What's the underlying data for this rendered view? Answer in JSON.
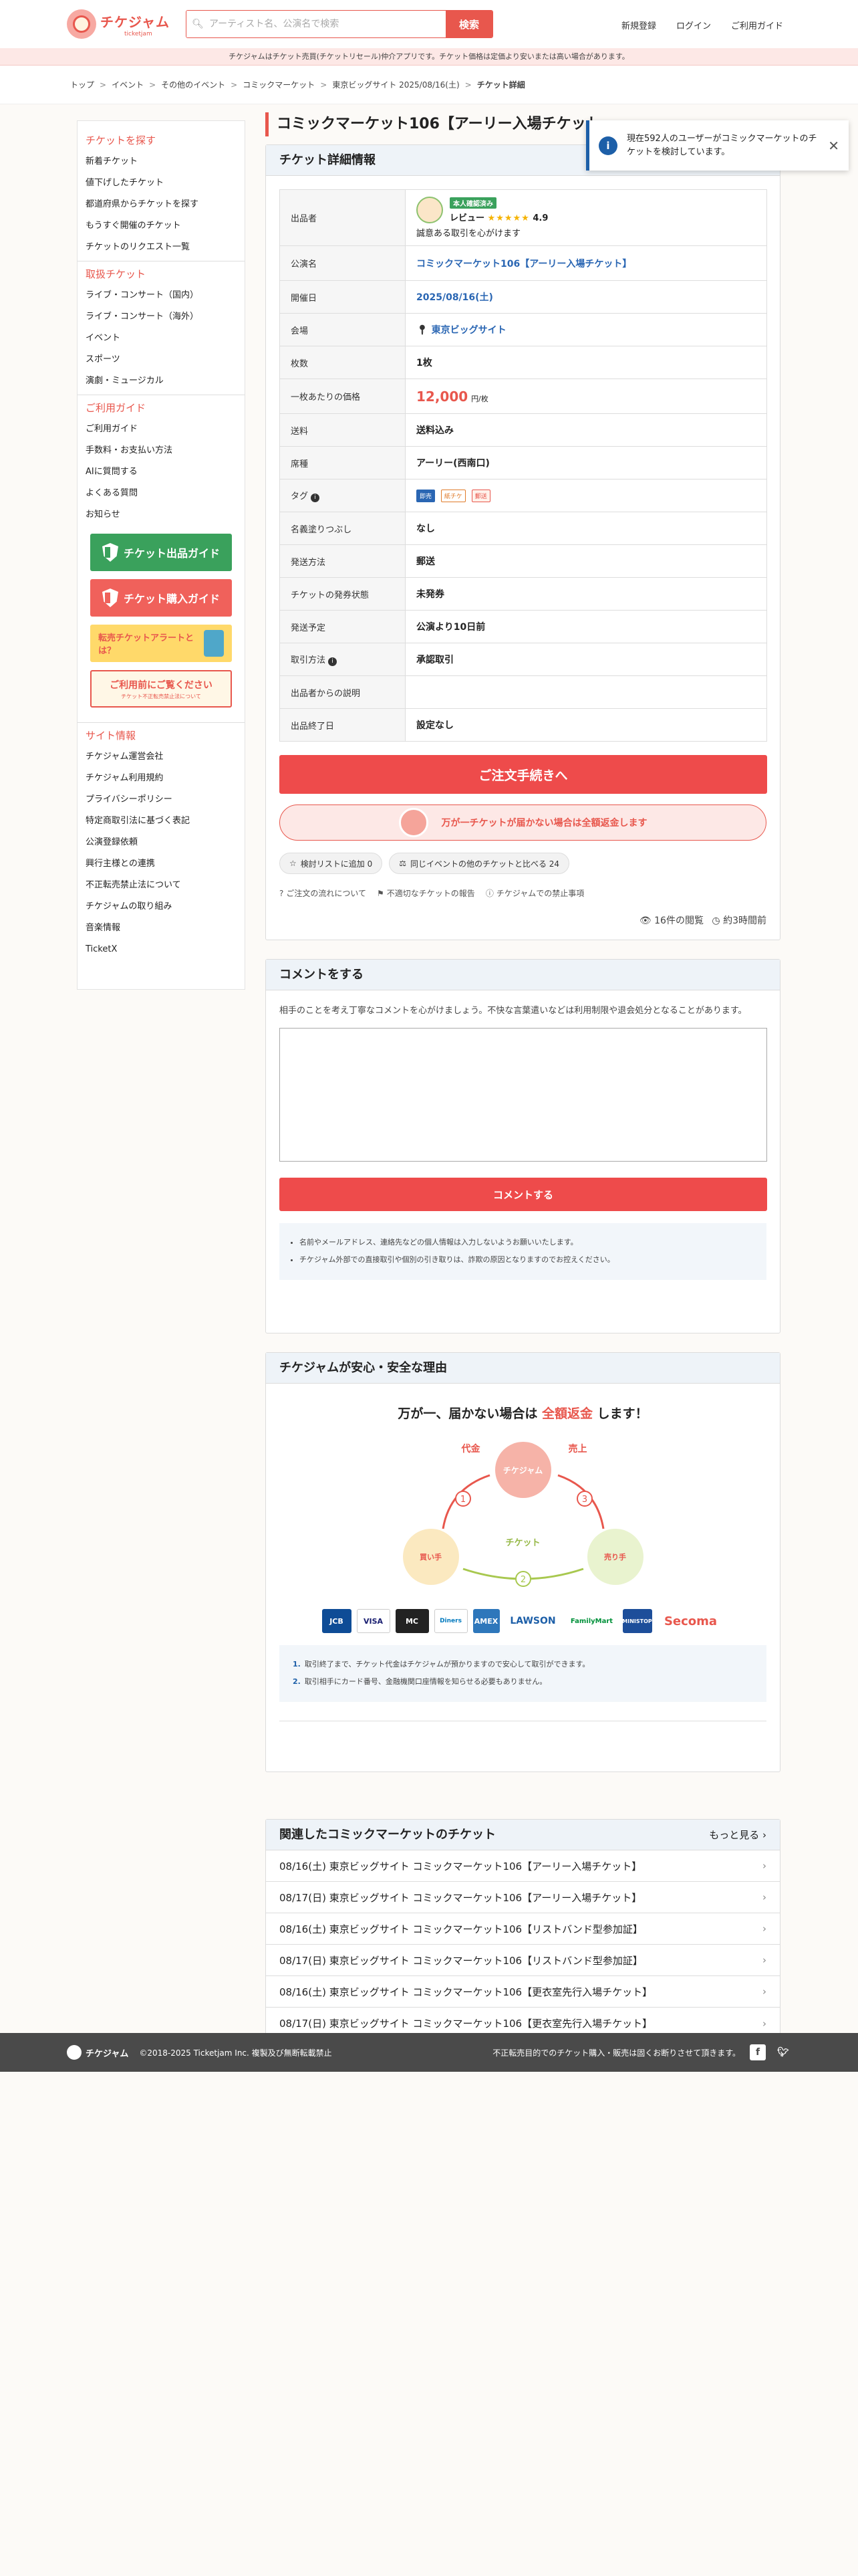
{
  "header": {
    "logo_text": "チケジャム",
    "logo_sub": "ticketjam",
    "search_placeholder": "アーティスト名、公演名で検索",
    "search_button": "検索",
    "nav": [
      "新規登録",
      "ログイン",
      "ご利用ガイド"
    ]
  },
  "notice": "チケジャムはチケット売買(チケットリセール)仲介アプリです。チケット価格は定価より安いまたは高い場合があります。",
  "breadcrumb": [
    "トップ",
    "イベント",
    "その他のイベント",
    "コミックマーケット",
    "東京ビッグサイト 2025/08/16(土)",
    "チケット詳細"
  ],
  "sidebar": {
    "sections": [
      {
        "title": "チケットを探す",
        "items": [
          "新着チケット",
          "値下げしたチケット",
          "都道府県からチケットを探す",
          "もうすぐ開催のチケット",
          "チケットのリクエスト一覧"
        ]
      },
      {
        "title": "取扱チケット",
        "items": [
          "ライブ・コンサート（国内）",
          "ライブ・コンサート（海外）",
          "イベント",
          "スポーツ",
          "演劇・ミュージカル"
        ]
      },
      {
        "title": "ご利用ガイド",
        "items": [
          "ご利用ガイド",
          "手数料・お支払い方法",
          "AIに質問する",
          "よくある質問",
          "お知らせ"
        ]
      }
    ],
    "banners": {
      "sell": "チケット出品ガイド",
      "buy": "チケット購入ガイド",
      "alert": "転売チケットアラートとは？",
      "before_use": "ご利用前にご覧ください",
      "before_use_sub": "チケット不正転売禁止法について"
    },
    "site_info": {
      "title": "サイト情報",
      "items": [
        "チケジャム運営会社",
        "チケジャム利用規約",
        "プライバシーポリシー",
        "特定商取引法に基づく表記",
        "公演登録依頼",
        "興行主様との連携",
        "不正転売禁止法について",
        "チケジャムの取り組み",
        "音楽情報",
        "TicketX"
      ]
    }
  },
  "page_title": "コミックマーケット106【アーリー入場チケット】",
  "toast": {
    "text": "現在592人のユーザーがコミックマーケットのチケットを検討しています。"
  },
  "detail": {
    "heading": "チケット詳細情報",
    "seller_label": "出品者",
    "verify_badge": "本人確認済み",
    "review_label": "レビュー",
    "rating": "4.9",
    "seller_note": "誠意ある取引を心がけます",
    "rows": [
      {
        "label": "公演名",
        "value": "コミックマーケット106【アーリー入場チケット】"
      },
      {
        "label": "開催日",
        "value": "2025/08/16(土)"
      },
      {
        "label": "会場",
        "value": "東京ビッグサイト"
      },
      {
        "label": "枚数",
        "value": "1枚"
      },
      {
        "label": "一枚あたりの価格",
        "value": "12,000",
        "unit": "円/枚"
      },
      {
        "label": "送料",
        "value": "送料込み"
      },
      {
        "label": "席種",
        "value": "アーリー(西南口)"
      },
      {
        "label": "タグ",
        "tags": [
          "即売",
          "紙チケ",
          "郵送"
        ]
      },
      {
        "label": "名義塗りつぶし",
        "value": "なし"
      },
      {
        "label": "発送方法",
        "value": "郵送"
      },
      {
        "label": "チケットの発券状態",
        "value": "未発券"
      },
      {
        "label": "発送予定",
        "value": "公演より10日前"
      },
      {
        "label": "取引方法",
        "value": "承認取引"
      },
      {
        "label": "出品者からの説明",
        "value": ""
      },
      {
        "label": "出品終了日",
        "value": "設定なし"
      }
    ],
    "order_button": "ご注文手続きへ",
    "refund_text": "万が一チケットが届かない場合は全額返金します",
    "wishlist": "検討リストに追加 0",
    "compare": "同じイベントの他のチケットと比べる 24",
    "links": [
      "ご注文の流れについて",
      "不適切なチケットの報告",
      "チケジャムでの禁止事項"
    ],
    "views": "16件の閲覧",
    "posted": "約3時間前"
  },
  "comment": {
    "heading": "コメントをする",
    "desc": "相手のことを考え丁寧なコメントを心がけましょう。不快な言葉遣いなどは利用制限や退会処分となることがあります。",
    "button": "コメントする",
    "notes": [
      "名前やメールアドレス、連絡先などの個人情報は入力しないようお願いいたします。",
      "チケジャム外部での直接取引や個別の引き取りは、詐欺の原因となりますのでお控えください。"
    ]
  },
  "safety": {
    "heading": "チケジャムが安心・安全な理由",
    "title_pre": "万が一、届かない場合は",
    "title_em": "全額返金",
    "title_post": "します！",
    "labels": {
      "payment": "代金",
      "sales": "売上",
      "ticket": "チケット",
      "buyer": "買い手",
      "seller": "売り手",
      "center": "チケジャム"
    },
    "payments": [
      "JCB",
      "VISA",
      "MC",
      "Diners",
      "AMEX",
      "LAWSON",
      "FamilyMart",
      "MINISTOP",
      "Secoma"
    ],
    "notes": [
      "取引終了まで、チケット代金はチケジャムが預かりますので安心して取引ができます。",
      "取引相手にカード番号、金融機関口座情報を知らせる必要もありません。"
    ]
  },
  "related": {
    "heading": "関連したコミックマーケットのチケット",
    "more": "もっと見る",
    "items": [
      "08/16(土) 東京ビッグサイト コミックマーケット106【アーリー入場チケット】",
      "08/17(日) 東京ビッグサイト コミックマーケット106【アーリー入場チケット】",
      "08/16(土) 東京ビッグサイト コミックマーケット106【リストバンド型参加証】",
      "08/17(日) 東京ビッグサイト コミックマーケット106【リストバンド型参加証】",
      "08/16(土) 東京ビッグサイト コミックマーケット106【更衣室先行入場チケット】",
      "08/17(日) 東京ビッグサイト コミックマーケット106【更衣室先行入場チケット】"
    ]
  },
  "footer": {
    "logo": "チケジャム",
    "copyright": "©2018-2025 Ticketjam Inc. 複製及び無断転載禁止",
    "notice": "不正転売目的でのチケット購入・販売は固くお断りさせて頂きます。"
  }
}
